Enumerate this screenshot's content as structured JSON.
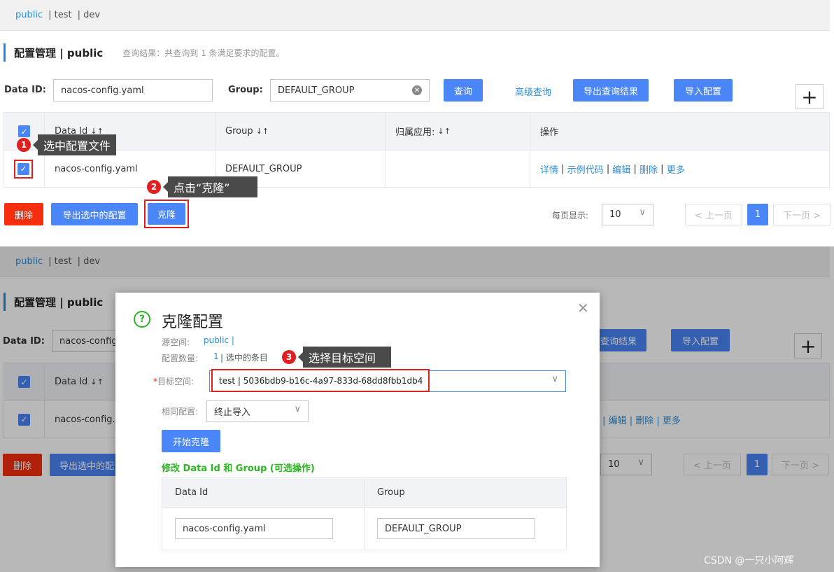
{
  "top": {
    "namespaces": [
      "public",
      "| test",
      "| dev"
    ],
    "title": "配置管理 | public",
    "result_hint": "查询结果：共查询到 1 条满足要求的配置。",
    "search": {
      "dataid_label": "Data ID:",
      "dataid_value": "nacos-config.yaml",
      "group_label": "Group:",
      "group_value": "DEFAULT_GROUP",
      "query_btn": "查询",
      "advanced_link": "高级查询",
      "export_btn": "导出查询结果",
      "import_btn": "导入配置",
      "add_btn": "+"
    },
    "table": {
      "headers": [
        "Data Id",
        "Group",
        "归属应用:",
        "操作"
      ],
      "sort_icon": "↓↑",
      "row": {
        "dataid": "nacos-config.yaml",
        "group": "DEFAULT_GROUP",
        "app": "",
        "actions": [
          "详情",
          "示例代码",
          "编辑",
          "删除",
          "更多"
        ]
      }
    },
    "footer": {
      "delete_btn": "删除",
      "export_sel_btn": "导出选中的配置",
      "clone_btn": "克隆",
      "page_size_label": "每页显示:",
      "page_size": "10",
      "prev": "< 上一页",
      "page": "1",
      "next": "下一页 >"
    },
    "tip1": {
      "num": "1",
      "text": "选中配置文件"
    },
    "tip2": {
      "num": "2",
      "text": "点击“克隆”"
    }
  },
  "bottom": {
    "namespaces": [
      "public",
      "| test",
      "| dev"
    ],
    "title": "配置管理 | public",
    "dataid_label": "Data ID:",
    "dataid_value": "nacos-config.",
    "export_partial": "查询结果",
    "import_btn": "导入配置",
    "add_btn": "+",
    "header_dataid": "Data Id",
    "row_dataid": "nacos-config.y",
    "actions_partial": "码 | 编辑 | 删除 | 更多",
    "delete_btn": "删除",
    "export_sel_partial": "导出选中的配",
    "page_size": "10",
    "prev": "< 上一页",
    "page": "1",
    "next": "下一页 >",
    "modal": {
      "title": "克隆配置",
      "source_label": "源空间:",
      "source_value": "public |",
      "count_label": "配置数量:",
      "count_value": "1",
      "count_suffix": "| 选中的条目",
      "target_label": "目标空间:",
      "target_value": "test | 5036bdb9-b16c-4a97-833d-68dd8fbb1db4",
      "same_label": "相同配置:",
      "same_value": "终止导入",
      "start_btn": "开始克隆",
      "modify_title": "修改 Data Id 和 Group (可选操作)",
      "col_dataid": "Data Id",
      "col_group": "Group",
      "edit_dataid": "nacos-config.yaml",
      "edit_group": "DEFAULT_GROUP"
    },
    "tip3": {
      "num": "3",
      "text": "选择目标空间"
    }
  },
  "watermark": "CSDN @一只小阿辉",
  "colors": {
    "accent": "#4a86f7",
    "danger": "#f52e0d",
    "link": "#2a8fd8",
    "green": "#2bb520"
  }
}
